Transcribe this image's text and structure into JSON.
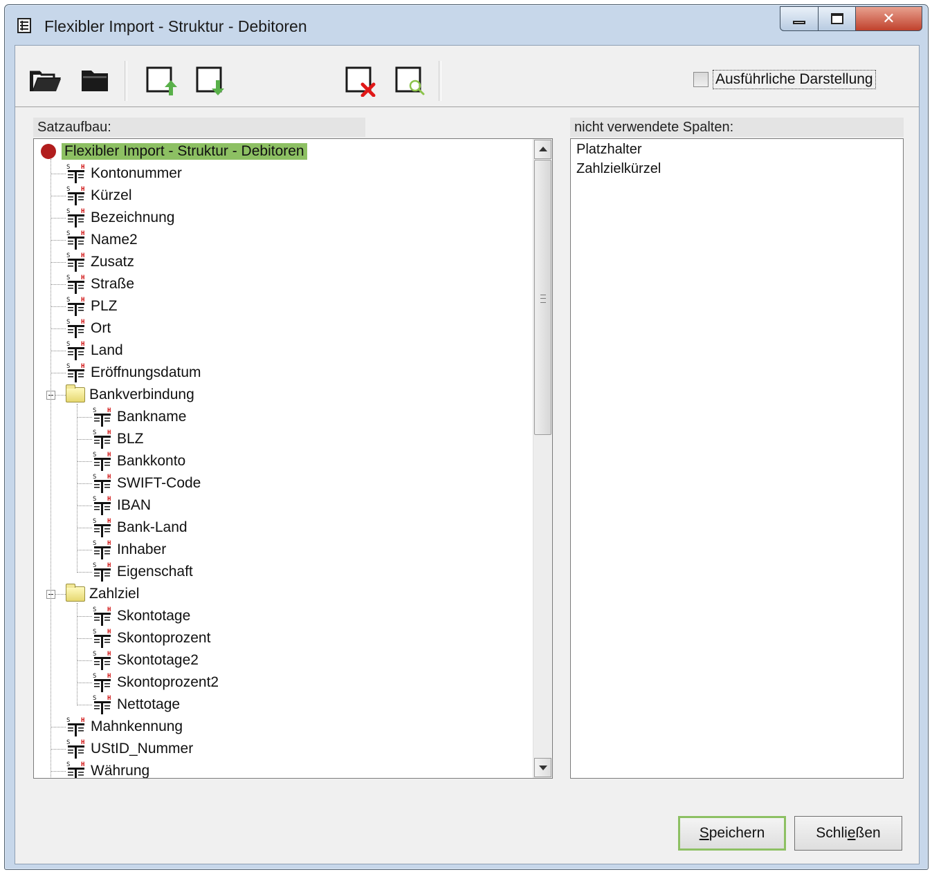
{
  "window": {
    "title": "Flexibler Import - Struktur - Debitoren"
  },
  "toolbar": {
    "buttons": [
      {
        "name": "open-folder",
        "icon": "folder-open-icon"
      },
      {
        "name": "folder",
        "icon": "folder-icon"
      },
      {
        "name": "export",
        "icon": "export-icon"
      },
      {
        "name": "import",
        "icon": "import-icon"
      },
      {
        "name": "delete",
        "icon": "delete-icon"
      },
      {
        "name": "preview",
        "icon": "preview-icon"
      }
    ],
    "detail_checkbox": {
      "label": "Ausführliche Darstellung",
      "checked": false
    }
  },
  "tree_section": {
    "label": "Satzaufbau:",
    "root": "Flexibler Import - Struktur - Debitoren",
    "fields_top": [
      "Kontonummer",
      "Kürzel",
      "Bezeichnung",
      "Name2",
      "Zusatz",
      "Straße",
      "PLZ",
      "Ort",
      "Land",
      "Eröffnungsdatum"
    ],
    "group1": {
      "label": "Bankverbindung",
      "children": [
        "Bankname",
        "BLZ",
        "Bankkonto",
        "SWIFT-Code",
        "IBAN",
        "Bank-Land",
        "Inhaber",
        "Eigenschaft"
      ]
    },
    "group2": {
      "label": "Zahlziel",
      "children": [
        "Skontotage",
        "Skontoprozent",
        "Skontotage2",
        "Skontoprozent2",
        "Nettotage"
      ]
    },
    "fields_bottom": [
      "Mahnkennung",
      "UStID_Nummer",
      "Währung"
    ]
  },
  "unused_section": {
    "label": "nicht verwendete Spalten:",
    "items": [
      "Platzhalter",
      "Zahlzielkürzel"
    ]
  },
  "buttons": {
    "save": {
      "label": "Speichern",
      "accel_before": "",
      "accel": "S",
      "accel_after": "peichern"
    },
    "close": {
      "label": "Schließen",
      "accel_before": "Schli",
      "accel": "e",
      "accel_after": "ßen"
    }
  },
  "colors": {
    "accent_green": "#8dc063",
    "root_dot": "#b11d1d",
    "delete_red": "#e01818",
    "arrow_green": "#59b04a"
  }
}
